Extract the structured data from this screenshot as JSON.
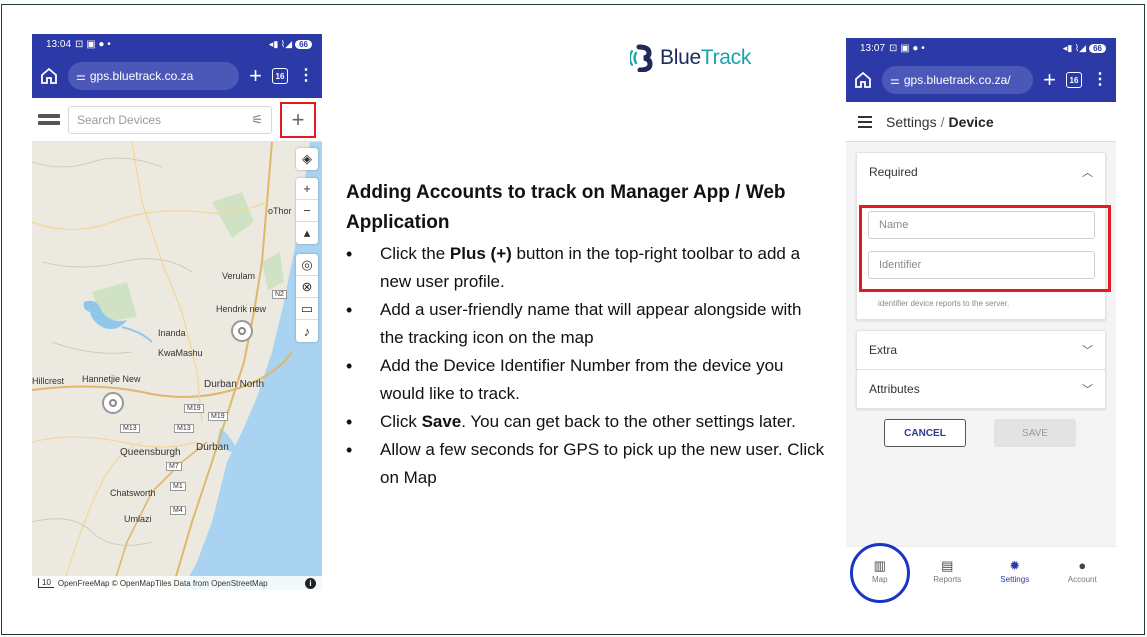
{
  "logo": {
    "brand_part1": "Blue",
    "brand_part2": "Track",
    "color_primary": "#1e2a5c",
    "color_accent": "#18a4ae"
  },
  "instructions": {
    "title": "Adding Accounts to track on Manager App / Web Application",
    "items": [
      {
        "before": "Click the ",
        "bold": "Plus (+)",
        "after": " button in the top-right toolbar to add a new user profile."
      },
      {
        "before": "Add a user-friendly name that will appear alongside with the tracking icon on the map",
        "bold": "",
        "after": ""
      },
      {
        "before": "Add the Device Identifier Number from the device you would like to track.",
        "bold": "",
        "after": ""
      },
      {
        "before": "Click ",
        "bold": "Save",
        "after": ". You can get back to the other settings later."
      },
      {
        "before": "Allow a few seconds for GPS to pick up the new user. Click on Map",
        "bold": "",
        "after": ""
      }
    ]
  },
  "left_phone": {
    "time": "13:04",
    "url": "gps.bluetrack.co.za",
    "tabs_count": "16",
    "search_placeholder": "Search Devices",
    "add_button_label": "+",
    "highlight_color": "#e21b23",
    "map_labels": {
      "othor": "oThor",
      "verulam": "Verulam",
      "hendrik": "Hendrik new",
      "inanda": "Inanda",
      "kwamashu": "KwaMashu",
      "hillcrest": "Hillcrest",
      "hannetjie": "Hannetjie New",
      "durban_north": "Durban North",
      "queensburgh": "Queensburgh",
      "durban": "Durban",
      "chatsworth": "Chatsworth",
      "umlazi": "Umlazi",
      "n2": "N2",
      "m19": "M19",
      "m19b": "M19",
      "m13": "M13",
      "m13b": "M13",
      "m7": "M7",
      "m1": "M1",
      "m4": "M4"
    },
    "scale_label": "10",
    "attribution": "OpenFreeMap © OpenMapTiles Data from OpenStreetMap",
    "info": "i"
  },
  "right_phone": {
    "time": "13:07",
    "url": "gps.bluetrack.co.za/",
    "tabs_count": "16",
    "breadcrumb_parent": "Settings",
    "breadcrumb_sep": "/",
    "breadcrumb_current": "Device",
    "required_label": "Required",
    "name_placeholder": "Name",
    "identifier_placeholder": "Identifier",
    "helper_text": "identifier device reports to the server.",
    "extra_label": "Extra",
    "attributes_label": "Attributes",
    "cancel_label": "CANCEL",
    "save_label": "SAVE",
    "nav": [
      {
        "label": "Map"
      },
      {
        "label": "Reports"
      },
      {
        "label": "Settings"
      },
      {
        "label": "Account"
      }
    ],
    "circle_color": "#1a33c8"
  }
}
